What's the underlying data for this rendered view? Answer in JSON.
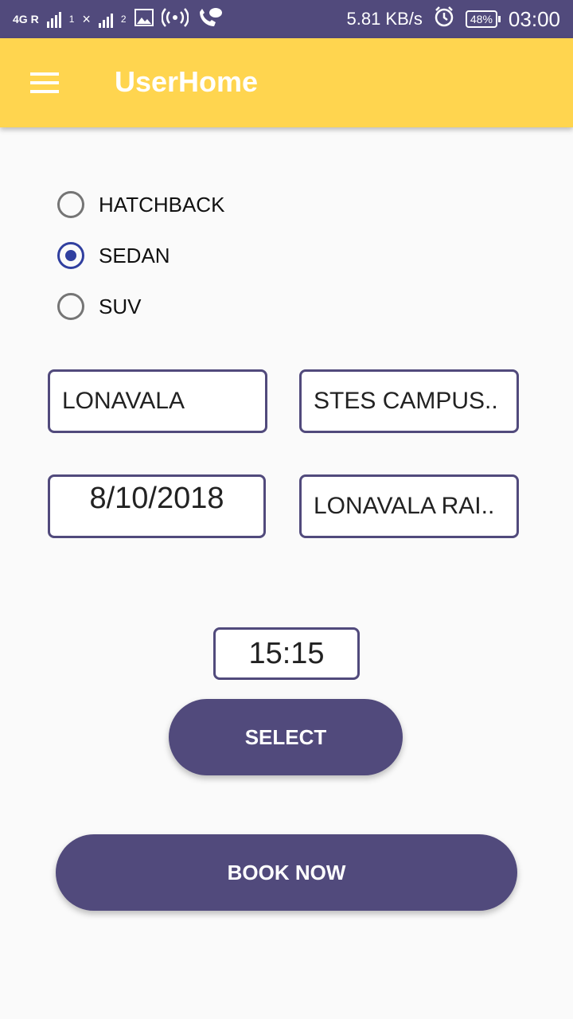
{
  "status_bar": {
    "network_label": "4G R",
    "sim1_label": "1",
    "sim2_label": "2",
    "speed": "5.81 KB/s",
    "battery": "48%",
    "time": "03:00",
    "icons": [
      "signal-icon",
      "gallery-icon",
      "hotspot-icon",
      "call-icon",
      "alarm-icon",
      "battery-icon"
    ]
  },
  "app_bar": {
    "title": "UserHome",
    "menu_icon": "hamburger-menu-icon",
    "background": "#ffd54f"
  },
  "car_type": {
    "options": [
      {
        "label": "HATCHBACK",
        "selected": false
      },
      {
        "label": "SEDAN",
        "selected": true
      },
      {
        "label": "SUV",
        "selected": false
      }
    ]
  },
  "booking": {
    "from": "LONAVALA",
    "to": "STES CAMPUS..",
    "date": "8/10/2018",
    "pickup": "LONAVALA RAI..",
    "time": "15:15"
  },
  "buttons": {
    "select": "SELECT",
    "book_now": "BOOK NOW"
  },
  "colors": {
    "primary": "#514a7c",
    "accent": "#303f9f"
  }
}
